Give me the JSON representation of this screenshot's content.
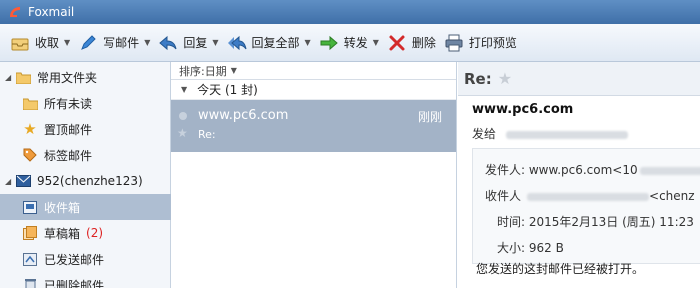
{
  "app": {
    "title": "Foxmail"
  },
  "toolbar": {
    "receive": "收取",
    "compose": "写邮件",
    "reply": "回复",
    "reply_all": "回复全部",
    "forward": "转发",
    "delete": "删除",
    "print_preview": "打印预览"
  },
  "sidebar": {
    "favorites": "常用文件夹",
    "items": [
      {
        "label": "所有未读"
      },
      {
        "label": "置顶邮件"
      },
      {
        "label": "标签邮件"
      }
    ],
    "account": "952(chenzhe123)",
    "folders": [
      {
        "label": "收件箱"
      },
      {
        "label": "草稿箱",
        "count": "(2)"
      },
      {
        "label": "已发送邮件"
      },
      {
        "label": "已删除邮件"
      }
    ]
  },
  "list": {
    "sort_label": "排序:日期",
    "group_label": "今天 (1 封)",
    "mail": {
      "from": "www.pc6.com",
      "time": "刚刚",
      "subject": "Re:"
    }
  },
  "reader": {
    "subject": "Re:",
    "sender": "www.pc6.com",
    "to_label": "发给",
    "from_line": "发件人: www.pc6.com<10",
    "to_line": "收件人",
    "to_line_tail": "<chenz",
    "time_line": "时间: 2015年2月13日 (周五) 11:23",
    "size_line": "大小: 962 B",
    "body": "您发送的这封邮件已经被打开。"
  },
  "colors": {
    "titlebar": "#4f7fb8",
    "selection": "#a3b3c7",
    "draft_count": "#dd2222"
  }
}
